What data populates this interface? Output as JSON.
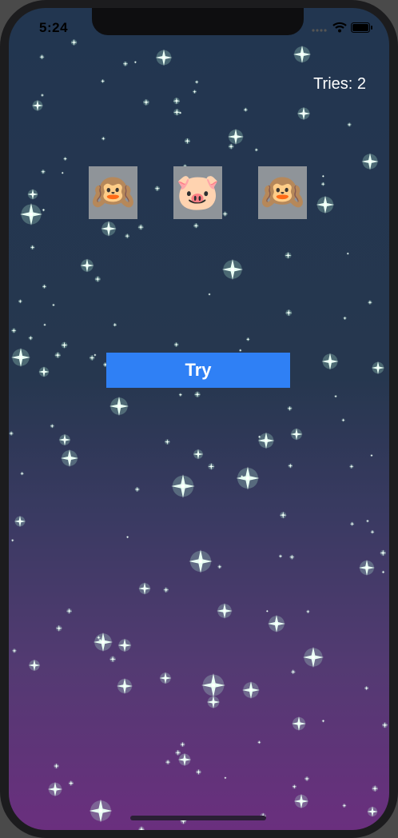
{
  "status_bar": {
    "time": "5:24",
    "icons": [
      "signal-dots-icon",
      "wifi-icon",
      "battery-icon"
    ]
  },
  "game": {
    "tries_label": "Tries: 2",
    "slots": [
      "🙉",
      "🐷",
      "🙉"
    ],
    "slot_names": [
      "hear-no-evil-monkey",
      "pig-face",
      "hear-no-evil-monkey"
    ],
    "try_button_label": "Try"
  },
  "colors": {
    "background_top": "#223650",
    "background_bottom": "#6a2f7e",
    "button": "#2f80f5",
    "slot_bg": "#8f9499"
  }
}
